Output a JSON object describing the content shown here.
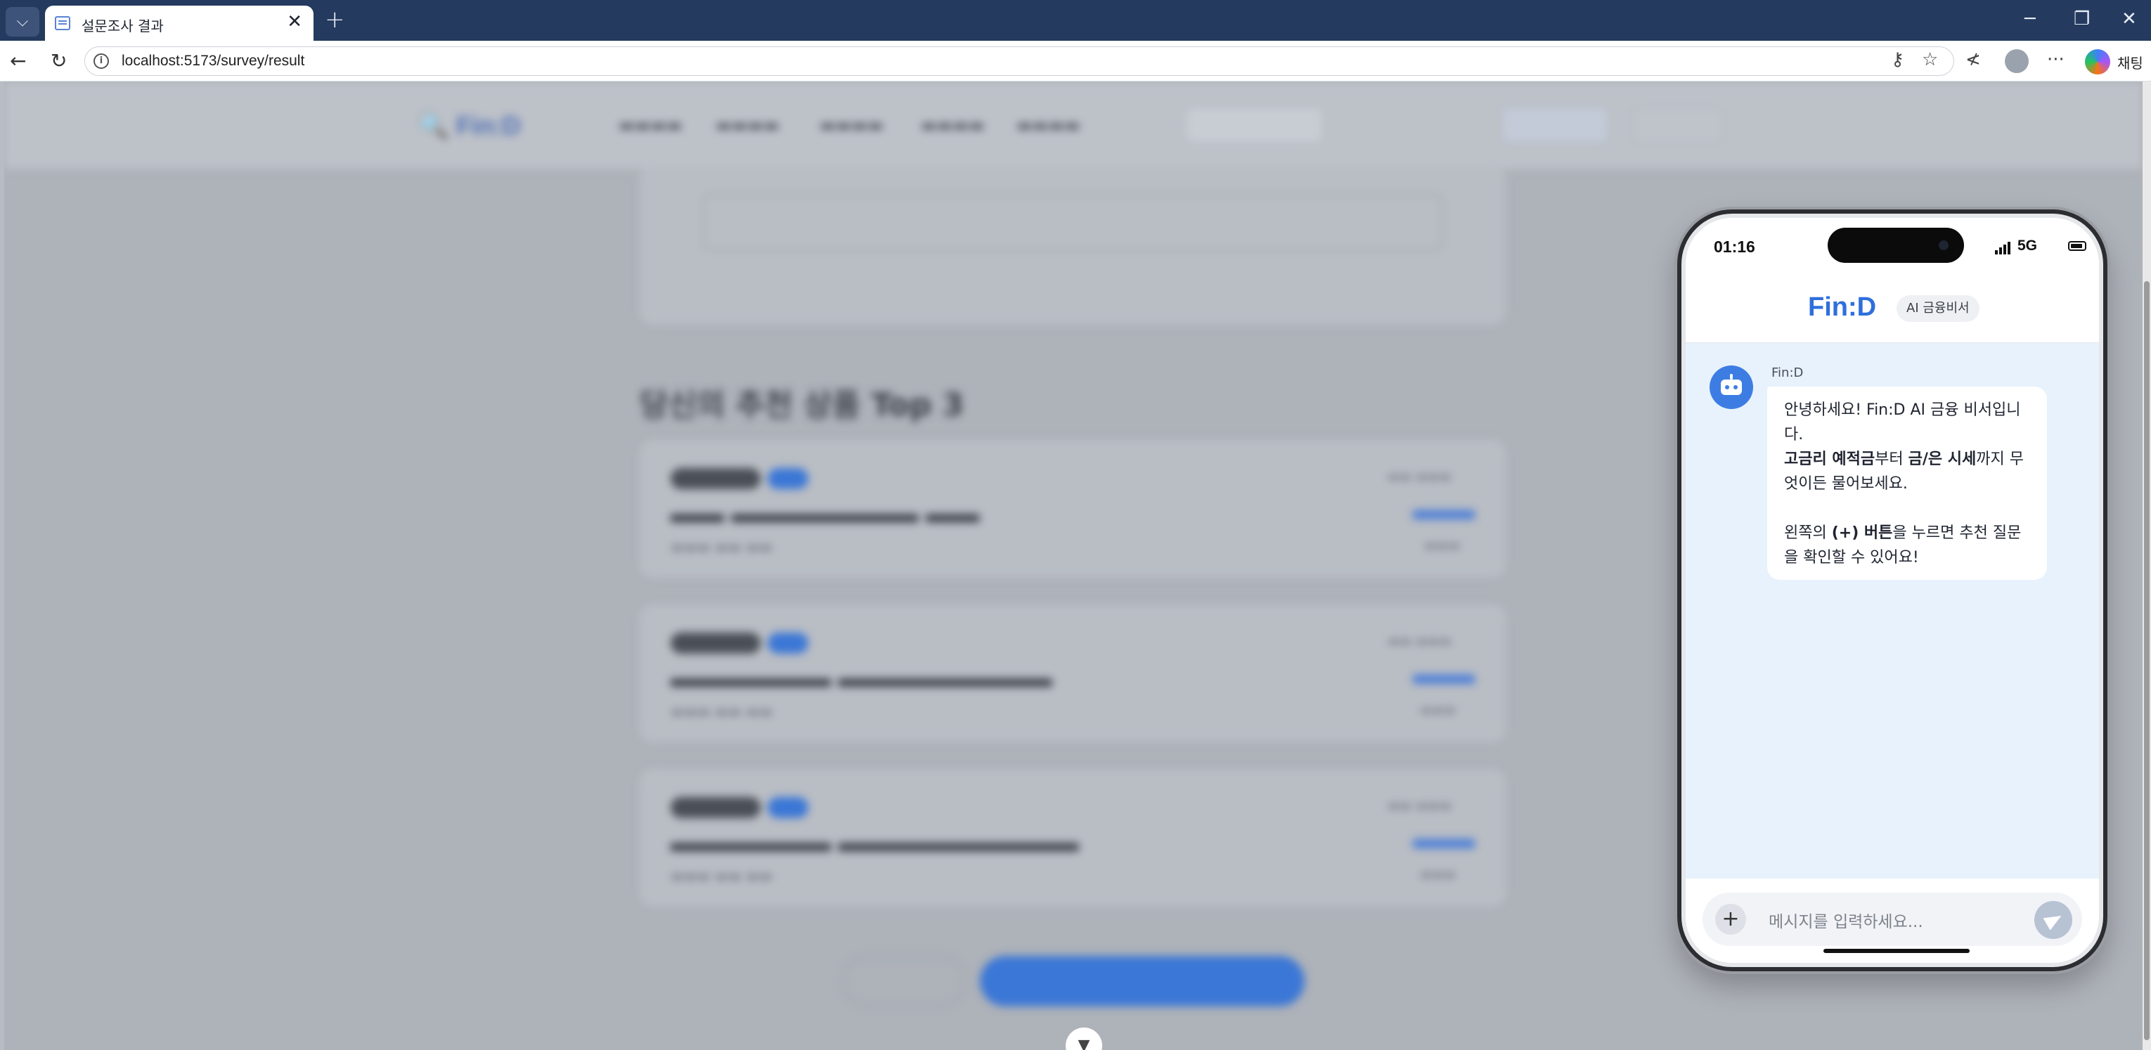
{
  "browser": {
    "tab_title": "설문조사 결과",
    "tab_close": "✕",
    "new_tab": "+",
    "url": "localhost:5173/survey/result",
    "sidebar_label": "채팅"
  },
  "phone": {
    "time": "01:16",
    "network": "5G",
    "brand": "Fin:D",
    "brand_badge": "AI 금융비서",
    "bot_name": "Fin:D",
    "message": {
      "line1": "안녕하세요! Fin:D AI 금융 비서입니다.",
      "bold1": "고금리 예적금",
      "text2": "부터 ",
      "bold2": "금/은 시세",
      "text3": "까지 무엇이든 물어보세요.",
      "text4": "왼쪽의 ",
      "bold3": "(+) 버튼",
      "text5": "을 누르면 추천 질문을 확인할 수 있어요!"
    },
    "input_placeholder": "메시지를 입력하세요..."
  },
  "background_page": {
    "section_title": "당신의 추천 상품 Top 3"
  },
  "colors": {
    "tabbar": "#243a5e",
    "brand_blue": "#2f6fdc",
    "chat_bg": "#e7f2fc",
    "avatar": "#3d7de3"
  },
  "icons": [
    "tab-menu-icon",
    "back-icon",
    "refresh-icon",
    "info-icon",
    "key-icon",
    "star-icon",
    "favorites-icon",
    "profile-icon",
    "more-icon",
    "copilot-icon",
    "robot-icon",
    "plus-icon",
    "send-icon"
  ]
}
